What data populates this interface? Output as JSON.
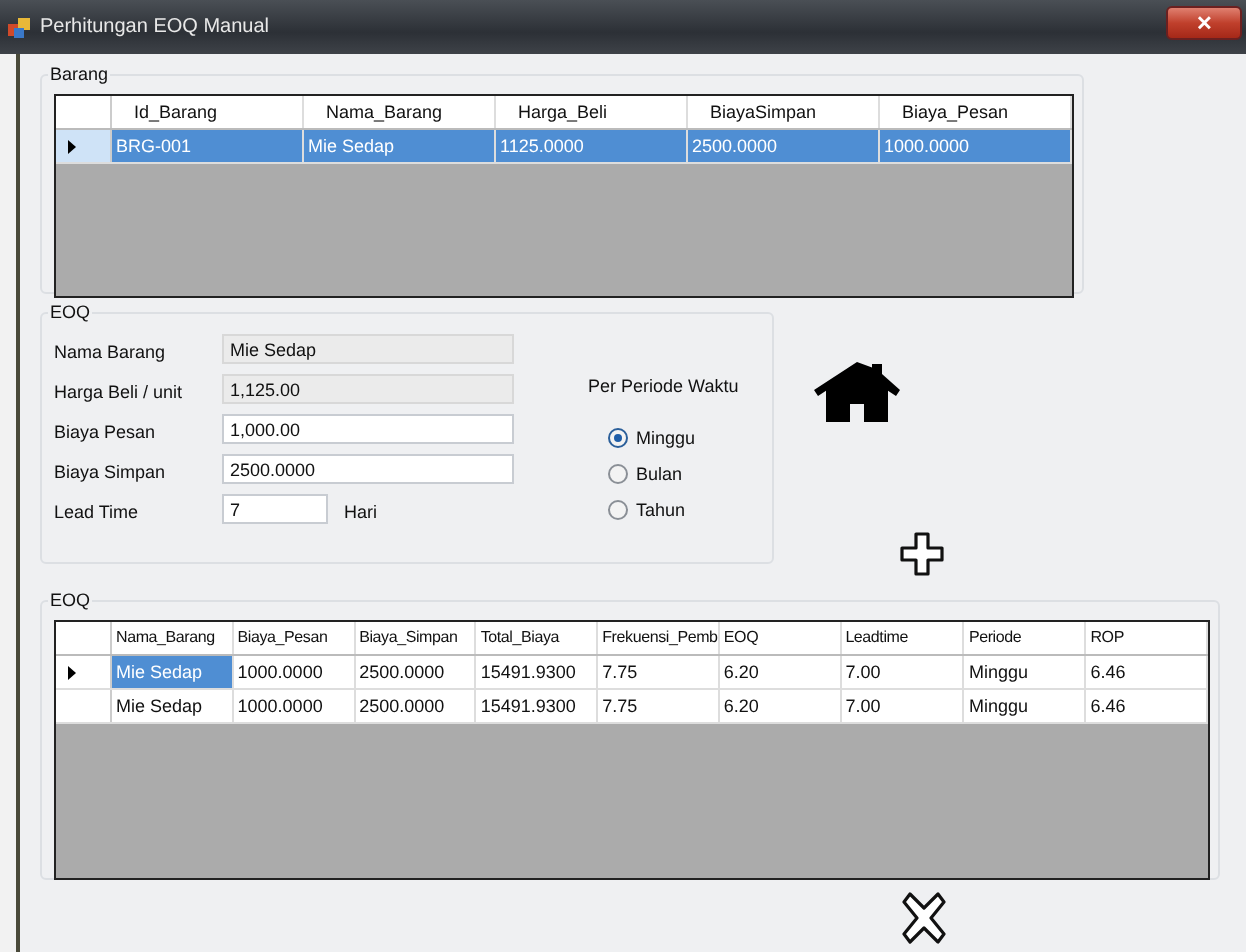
{
  "window": {
    "title": "Perhitungan EOQ Manual",
    "close": "✕"
  },
  "barang": {
    "label": "Barang",
    "full_row_select": true,
    "columns": [
      "Id_Barang",
      "Nama_Barang",
      "Harga_Beli",
      "BiayaSimpan",
      "Biaya_Pesan"
    ],
    "rows": [
      {
        "selected": true,
        "cells": [
          "BRG-001",
          "Mie Sedap",
          "1125.0000",
          "2500.0000",
          "1000.0000"
        ]
      }
    ]
  },
  "eoq_form": {
    "label": "EOQ",
    "fields": [
      {
        "label": "Nama Barang",
        "value": "Mie Sedap",
        "disabled": true
      },
      {
        "label": "Harga Beli / unit",
        "value": "1,125.00",
        "disabled": true
      },
      {
        "label": "Biaya Pesan",
        "value": "1,000.00",
        "disabled": false
      },
      {
        "label": "Biaya Simpan",
        "value": "2500.0000",
        "disabled": false
      },
      {
        "label": "Lead Time",
        "value": "7",
        "disabled": false,
        "suffix": "Hari"
      }
    ],
    "period_label": "Per Periode Waktu",
    "periods": [
      {
        "label": "Minggu",
        "selected": true
      },
      {
        "label": "Bulan",
        "selected": false
      },
      {
        "label": "Tahun",
        "selected": false
      }
    ]
  },
  "hasil": {
    "label": "EOQ",
    "full_row_select": false,
    "columns": [
      "Nama_Barang",
      "Biaya_Pesan",
      "Biaya_Simpan",
      "Total_Biaya",
      "Frekuensi_Pemb",
      "EOQ",
      "Leadtime",
      "Periode",
      "ROP"
    ],
    "rows": [
      {
        "selected": true,
        "cells": [
          "Mie Sedap",
          "1000.0000",
          "2500.0000",
          "15491.9300",
          "7.75",
          "6.20",
          "7.00",
          "Minggu",
          "6.46"
        ]
      },
      {
        "selected": false,
        "cells": [
          "Mie Sedap",
          "1000.0000",
          "2500.0000",
          "15491.9300",
          "7.75",
          "6.20",
          "7.00",
          "Minggu",
          "6.46"
        ]
      }
    ]
  }
}
